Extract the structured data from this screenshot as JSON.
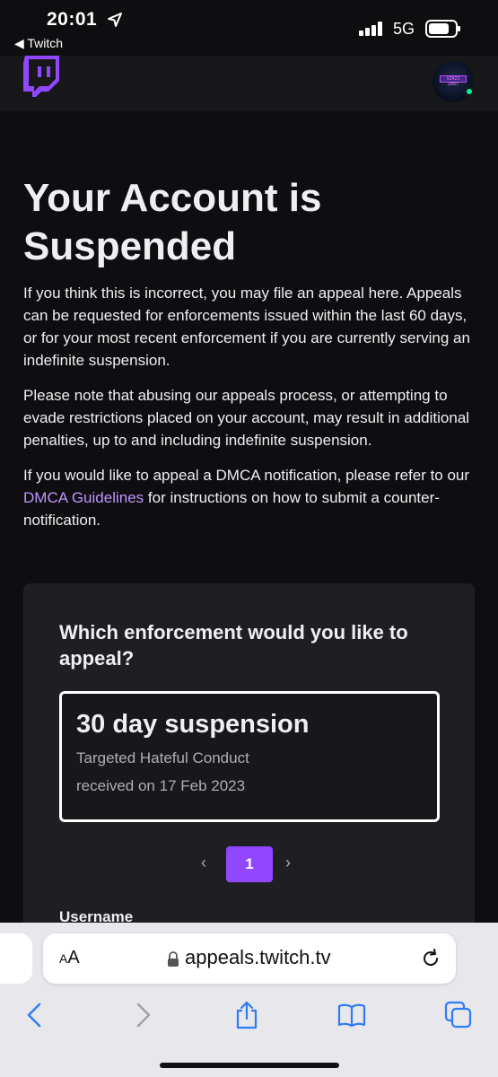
{
  "status_bar": {
    "time": "20:01",
    "back_app": "◀ Twitch",
    "network": "5G"
  },
  "nav": {
    "avatar_tag": "SIRIS 2007",
    "brand_color": "#9147ff"
  },
  "page": {
    "title": "Your Account is Suspended",
    "para1": "If you think this is incorrect, you may file an appeal here. Appeals can be requested for enforcements issued within the last 60 days, or for your most recent enforcement if you are currently serving an indefinite suspension.",
    "para2": "Please note that abusing our appeals process, or attempting to evade restrictions placed on your account, may result in additional penalties, up to and including indefinite suspension.",
    "para3_before": "If you would like to appeal a DMCA notification, please refer to our ",
    "para3_link": "DMCA Guidelines",
    "para3_after": " for instructions on how to submit a counter-notification."
  },
  "card": {
    "question": "Which enforcement would you like to appeal?",
    "enforcement": {
      "title": "30 day suspension",
      "reason": "Targeted Hateful Conduct",
      "received": "received on 17 Feb 2023"
    },
    "pagination": {
      "prev": "‹",
      "current": "1",
      "next": "›"
    },
    "username_label": "Username"
  },
  "safari": {
    "aa_small": "A",
    "aa_large": "A",
    "url": "appeals.twitch.tv",
    "toolbar_icons": [
      "back-icon",
      "forward-icon",
      "share-icon",
      "bookmarks-icon",
      "tabs-icon"
    ]
  }
}
